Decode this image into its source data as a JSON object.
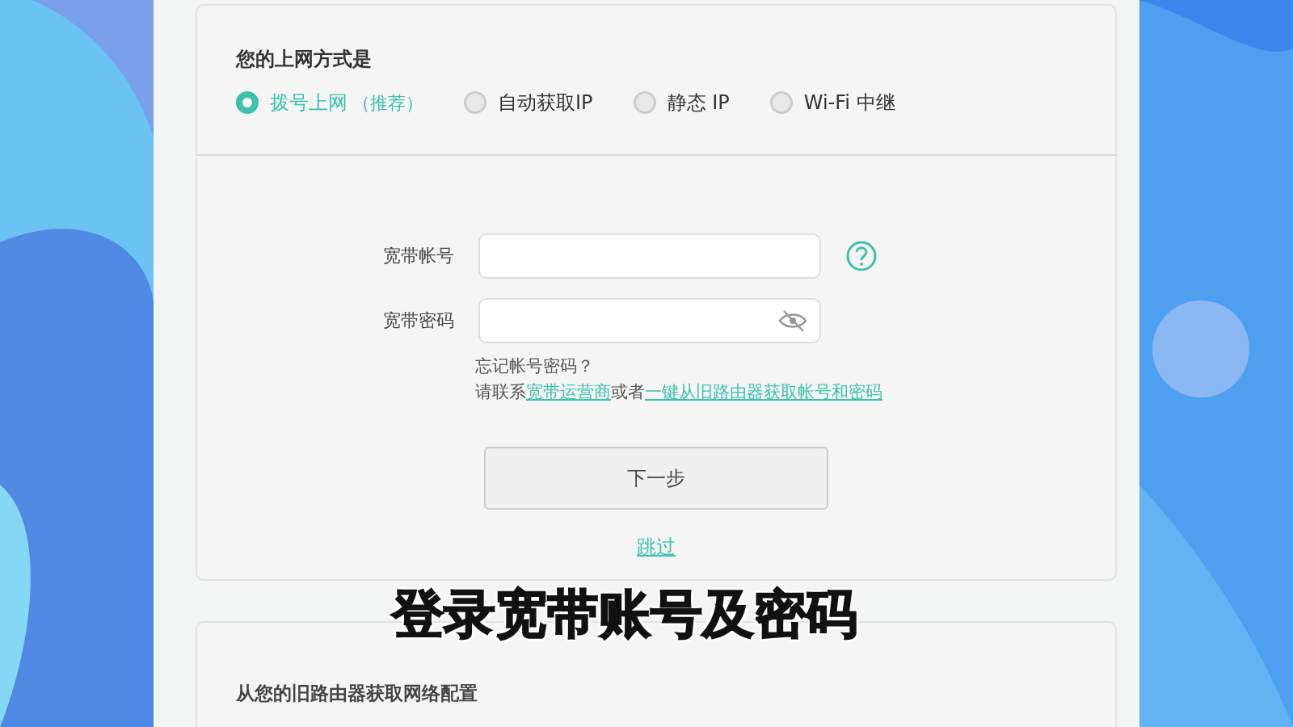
{
  "section_title": "您的上网方式是",
  "modes": [
    {
      "label": "拨号上网",
      "note": "（推荐）",
      "selected": true
    },
    {
      "label": "自动获取IP",
      "selected": false
    },
    {
      "label": "静态 IP",
      "selected": false
    },
    {
      "label": "Wi-Fi 中继",
      "selected": false
    }
  ],
  "fields": [
    {
      "label": "宽带帐号",
      "kind": "text"
    },
    {
      "label": "宽带密码",
      "kind": "password"
    }
  ],
  "help": {
    "question": "忘记帐号密码？",
    "prefix": "请联系",
    "link_1": "宽带运营商",
    "middle": "或者",
    "link_2": "一键从旧路由器获取帐号和密码"
  },
  "next_button": "下一步",
  "skip_link": "跳过",
  "second_section_title": "从您的旧路由器获取网络配置",
  "subtitle": "登录宽带账号及密码"
}
